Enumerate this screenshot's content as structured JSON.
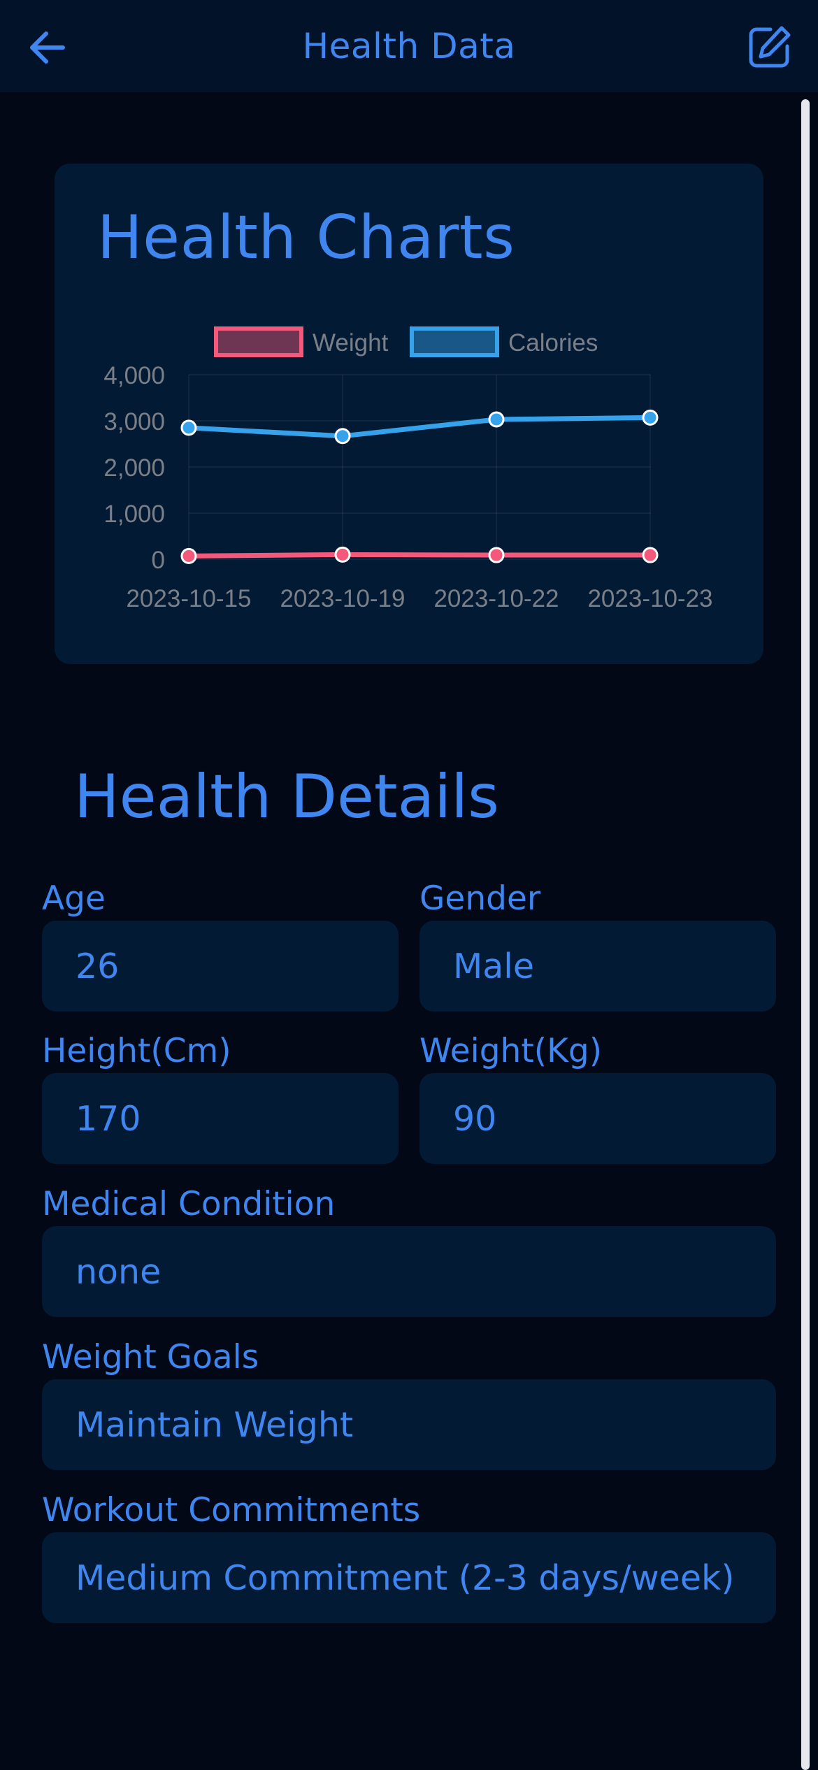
{
  "header": {
    "title": "Health Data",
    "back_icon": "arrow-left-icon",
    "edit_icon": "edit-square-icon"
  },
  "colors": {
    "accent": "#3f86f0",
    "weight_line": "#f4587a",
    "calories_line": "#36a2eb",
    "background": "#020816",
    "card": "#021a33"
  },
  "charts": {
    "title": "Health Charts"
  },
  "chart_data": {
    "type": "line",
    "title": "",
    "categories": [
      "2023-10-15",
      "2023-10-19",
      "2023-10-22",
      "2023-10-23"
    ],
    "series": [
      {
        "name": "Weight",
        "values": [
          70,
          100,
          90,
          90
        ]
      },
      {
        "name": "Calories",
        "values": [
          2850,
          2670,
          3030,
          3070
        ]
      }
    ],
    "ylim": [
      0,
      4000
    ],
    "yticks": [
      "4,000",
      "3,000",
      "2,000",
      "1,000",
      "0"
    ],
    "legend_position": "top",
    "grid": true
  },
  "details": {
    "title": "Health Details",
    "age_label": "Age",
    "age_value": "26",
    "gender_label": "Gender",
    "gender_value": "Male",
    "height_label": "Height(Cm)",
    "height_value": "170",
    "weight_label": "Weight(Kg)",
    "weight_value": "90",
    "medical_label": "Medical Condition",
    "medical_value": "none",
    "goals_label": "Weight Goals",
    "goals_value": "Maintain Weight",
    "workout_label": "Workout Commitments",
    "workout_value": "Medium Commitment (2-3 days/week)"
  }
}
